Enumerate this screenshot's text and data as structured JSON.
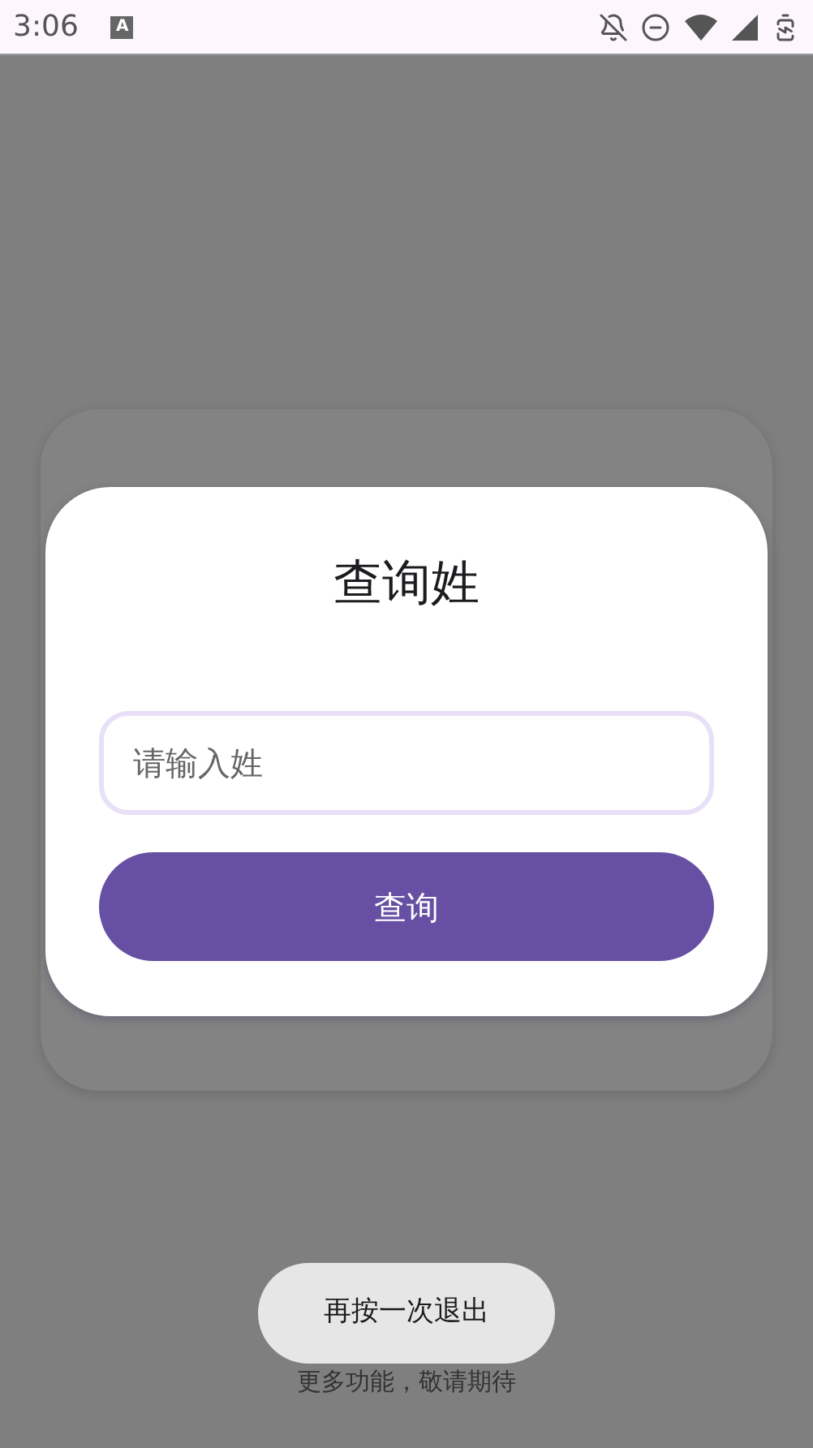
{
  "status_bar": {
    "time": "3:06",
    "app_badge": "A"
  },
  "dialog": {
    "title": "查询姓",
    "field": {
      "placeholder": "请输入姓"
    },
    "button": "查询"
  },
  "footer": "更多功能，敬请期待",
  "toast": "再按一次退出"
}
